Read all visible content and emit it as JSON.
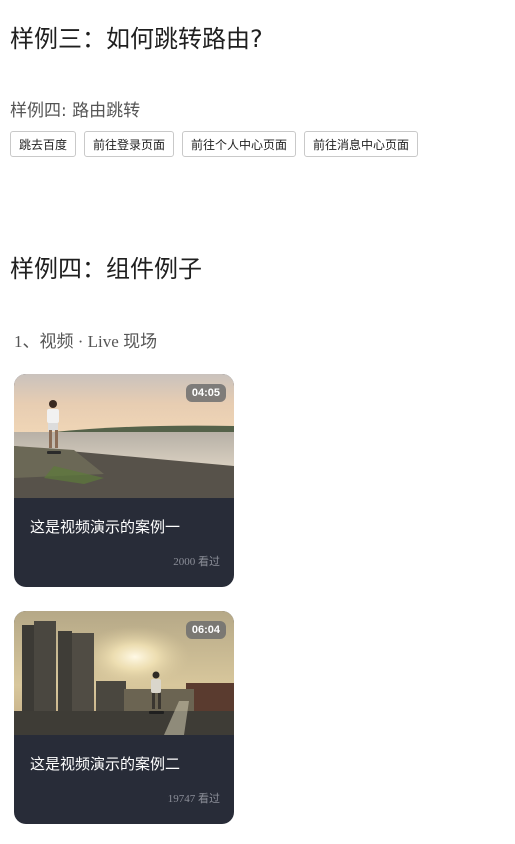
{
  "section3": {
    "title": "样例三：如何跳转路由?"
  },
  "section4a": {
    "subtitle": "样例四: 路由跳转",
    "buttons": [
      "跳去百度",
      "前往登录页面",
      "前往个人中心页面",
      "前往消息中心页面"
    ]
  },
  "section4b": {
    "title": "样例四：组件例子",
    "list_title": "1、视频 · Live 现场",
    "videos": [
      {
        "duration": "04:05",
        "title": "这是视频演示的案例一",
        "views": "2000 看过"
      },
      {
        "duration": "06:04",
        "title": "这是视频演示的案例二",
        "views": "19747 看过"
      }
    ]
  },
  "colors": {
    "card_bg": "#282c38",
    "duration_bg": "#6e6e6e",
    "views_text": "#8c8f99"
  }
}
